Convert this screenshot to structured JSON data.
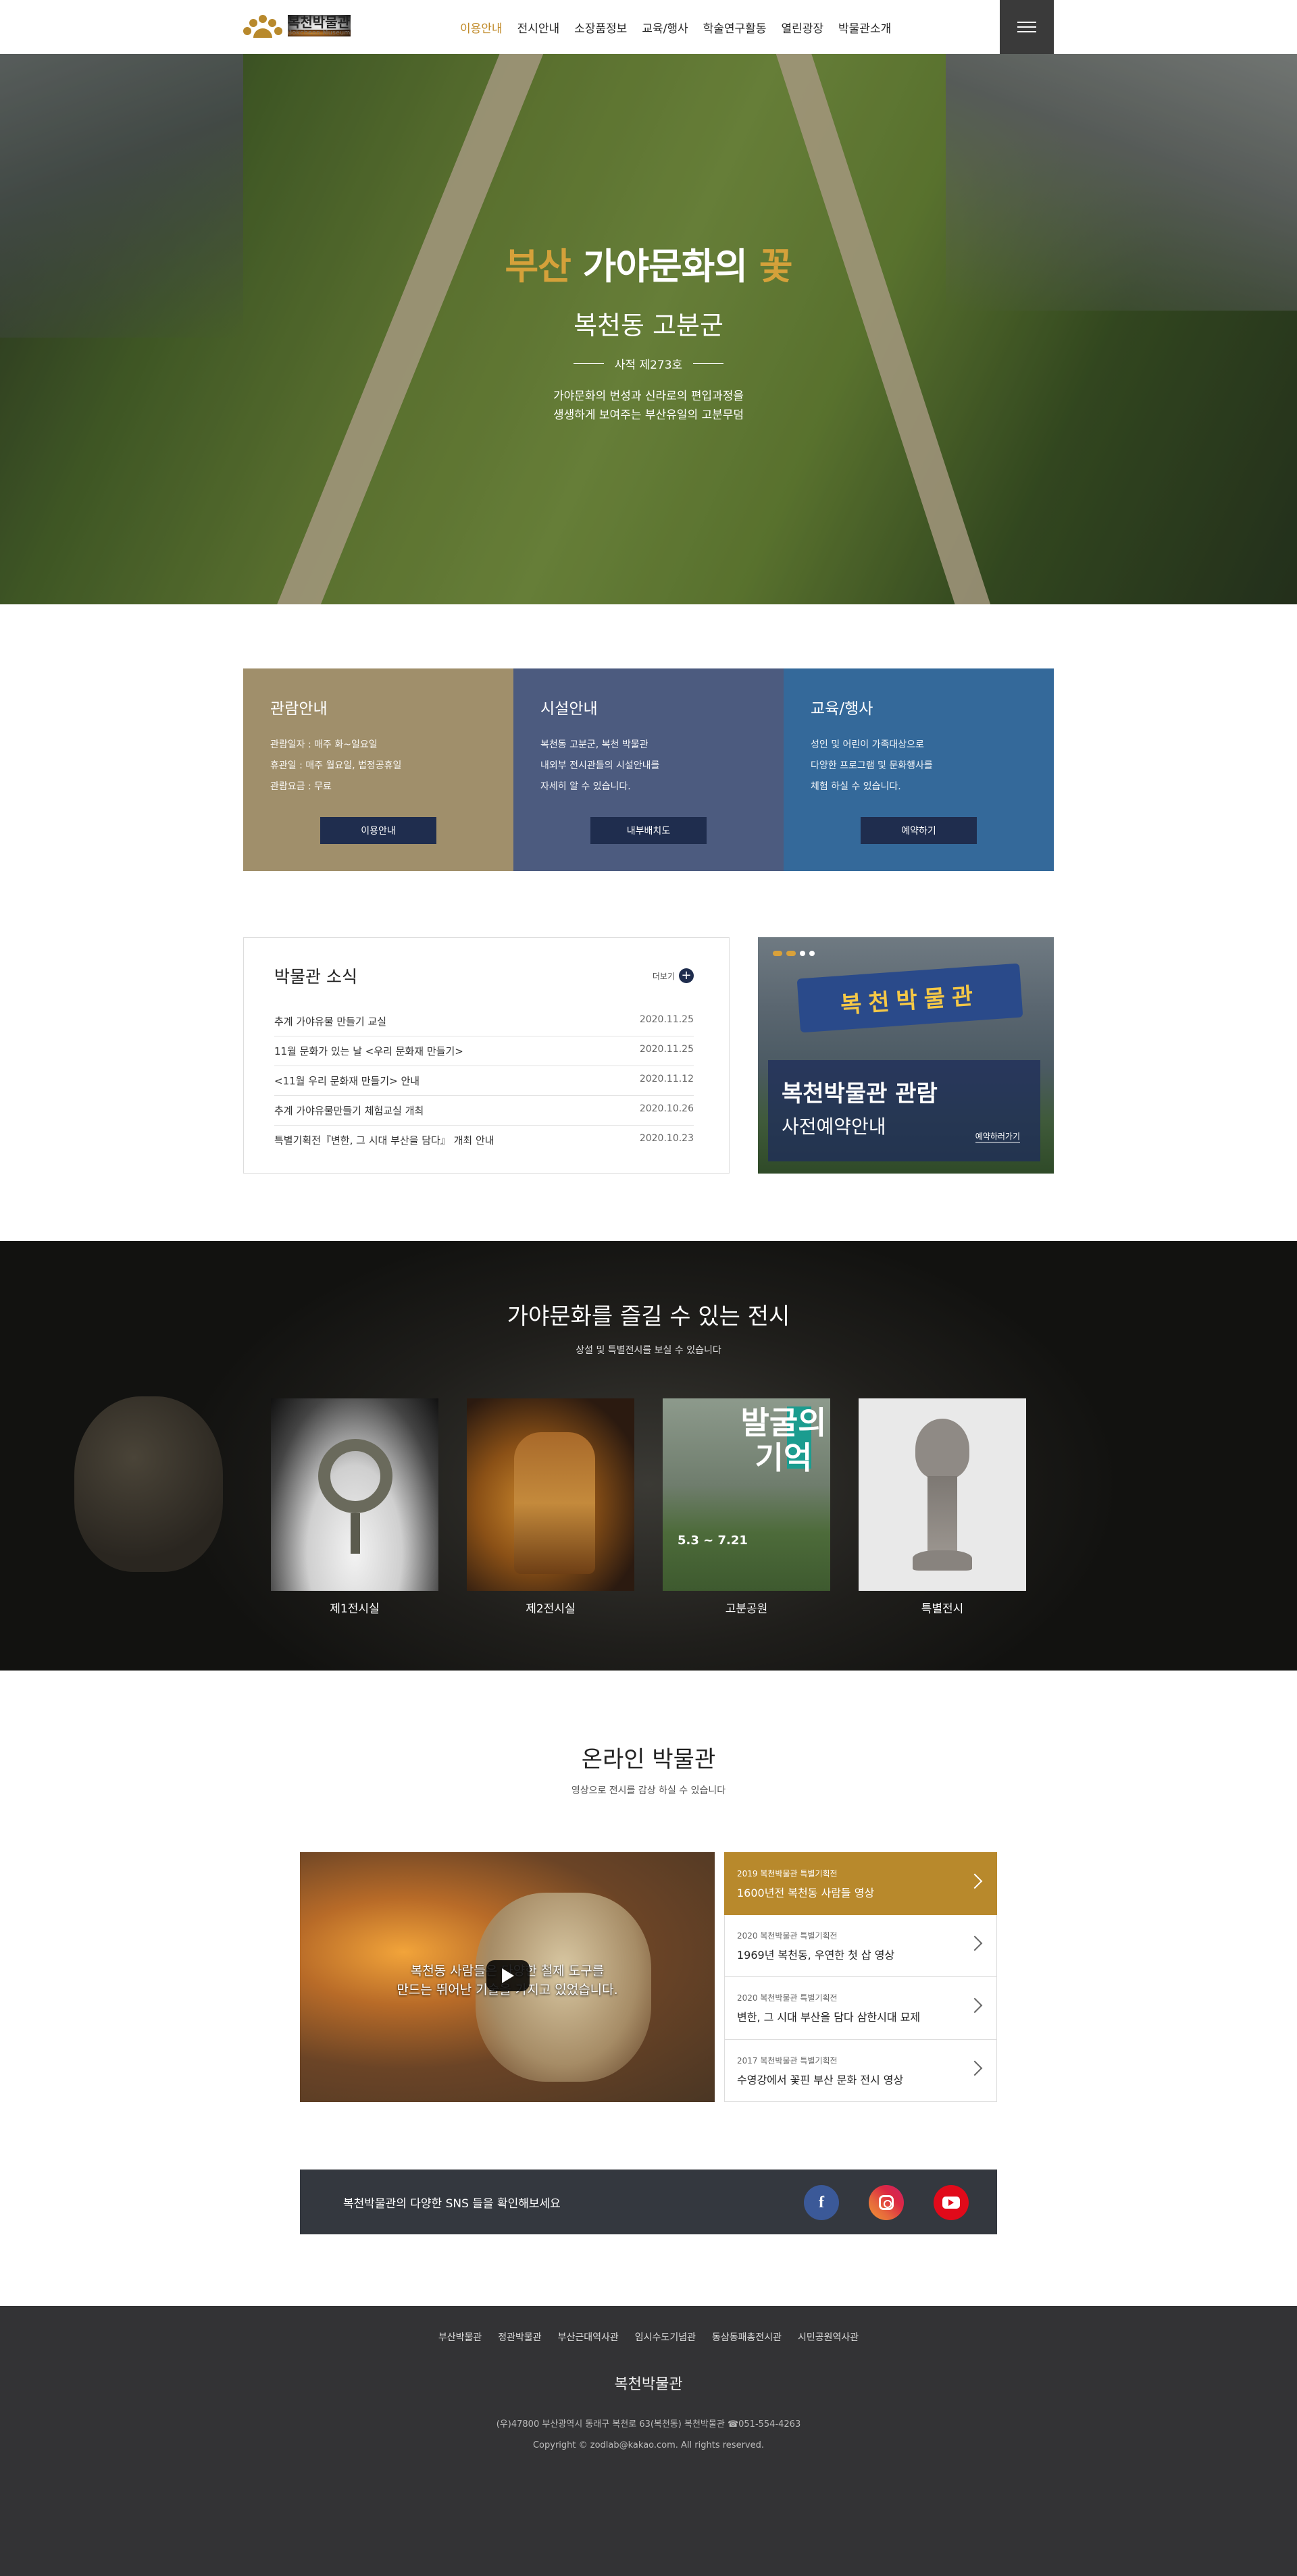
{
  "header": {
    "logo_name": "복천박물관",
    "logo_sub": "Bokcheon Museum",
    "nav": [
      "이용안내",
      "전시안내",
      "소장품정보",
      "교육/행사",
      "학술연구활동",
      "열린광장",
      "박물관소개"
    ]
  },
  "hero": {
    "title_accent": "부산",
    "title_main": " 가야문화의 ",
    "title_accent2": "꽃",
    "subtitle": "복천동 고분군",
    "badge": "사적 제273호",
    "desc1": "가야문화의 번성과 신라로의 편입과정을",
    "desc2": "생생하게 보여주는 부산유일의 고분무덤"
  },
  "cards": [
    {
      "title": "관람안내",
      "lines": [
        "관람일자 : 매주 화~일요일",
        "휴관일 : 매주 월요일, 법정공휴일",
        "관람요금 : 무료"
      ],
      "button": "이용안내"
    },
    {
      "title": "시설안내",
      "lines": [
        "복천동 고분군, 복천 박물관",
        "내외부 전시관들의 시설안내를",
        "자세히 알 수 있습니다."
      ],
      "button": "내부배치도"
    },
    {
      "title": "교육/행사",
      "lines": [
        "성인 및 어린이 가족대상으로",
        "다양한 프로그램 및 문화행사를",
        "체험 하실 수 있습니다."
      ],
      "button": "예약하기"
    }
  ],
  "news": {
    "title": "박물관 소식",
    "more": "더보기",
    "items": [
      {
        "title": "추계 가야유물 만들기 교실",
        "date": "2020.11.25"
      },
      {
        "title": "11월 문화가 있는 날 <우리 문화재 만들기>",
        "date": "2020.11.25"
      },
      {
        "title": "<11월 우리 문화재 만들기> 안내",
        "date": "2020.11.12"
      },
      {
        "title": "추계 가야유물만들기 체험교실 개최",
        "date": "2020.10.26"
      },
      {
        "title": "특별기획전『변한, 그 시대 부산을 담다』 개최 안내",
        "date": "2020.10.23"
      }
    ]
  },
  "reserve": {
    "sign": "복천박물관",
    "line1": "복천박물관 관람",
    "line2": "사전예약안내",
    "link": "예약하러가기"
  },
  "exhibit": {
    "title": "가야문화를 즐길 수 있는 전시",
    "sub": "상설 및 특별전시를 보실 수 있습니다",
    "items": [
      "제1전시실",
      "제2전시실",
      "고분공원",
      "특별전시"
    ],
    "poster_text": "발굴의 기억",
    "poster_date": "5.3 ~ 7.21"
  },
  "online": {
    "title": "온라인 박물관",
    "sub": "영상으로 전시를 감상 하실 수 있습니다",
    "caption1": "복천동 사람들은 다양한 철제 도구를",
    "caption2": "만드는 뛰어난 기술을 가지고 있었습니다.",
    "videos": [
      {
        "cat": "2019 복천박물관 특별기획전",
        "title": "1600년전 복천동 사람들 영상"
      },
      {
        "cat": "2020 복천박물관 특별기획전",
        "title": "1969년 복천동, 우연한 첫 삽 영상"
      },
      {
        "cat": "2020 복천박물관 특별기획전",
        "title": "변한, 그 시대 부산을 담다 삼한시대 묘제"
      },
      {
        "cat": "2017 복천박물관 특별기획전",
        "title": "수영강에서 꽃핀 부산 문화 전시 영상"
      }
    ]
  },
  "sns": {
    "text": "복천박물관의 다양한 SNS 들을 확인해보세요",
    "fb": "f"
  },
  "footer": {
    "links": [
      "부산박물관",
      "정관박물관",
      "부산근대역사관",
      "임시수도기념관",
      "동삼동패총전시관",
      "시민공원역사관"
    ],
    "name": "복천박물관",
    "address": "(우)47800 부산광역시 동래구 복천로 63(복천동) 복천박물관 ☎051-554-4263",
    "copyright": "Copyright © zodlab@kakao.com. All rights reserved."
  },
  "colors": {
    "gold": "#b8892c",
    "card1": "#a08f6b",
    "card2": "#4c5b7f",
    "card3": "#34699a",
    "navy": "#1f2d4e"
  }
}
